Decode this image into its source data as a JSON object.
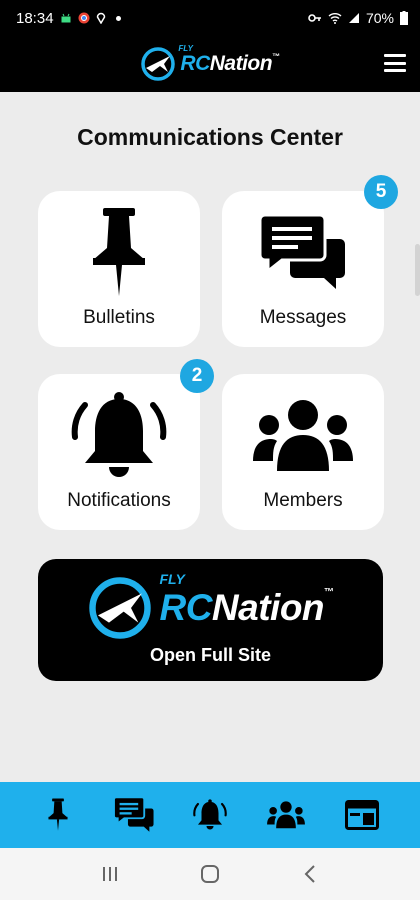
{
  "status_bar": {
    "time": "18:34",
    "battery": "70%"
  },
  "header": {
    "logo_fly": "FLY",
    "logo_rc": "RC",
    "logo_nation": "Nation",
    "logo_tm": "™",
    "menu_icon": "hamburger-menu-icon"
  },
  "page": {
    "title": "Communications Center"
  },
  "tiles": [
    {
      "label": "Bulletins",
      "icon": "pushpin-icon",
      "badge": ""
    },
    {
      "label": "Messages",
      "icon": "chat-bubbles-icon",
      "badge": "5"
    },
    {
      "label": "Notifications",
      "icon": "bell-ringing-icon",
      "badge": "2"
    },
    {
      "label": "Members",
      "icon": "group-icon",
      "badge": ""
    }
  ],
  "full_site": {
    "label": "Open Full Site",
    "logo_fly": "FLY",
    "logo_rc": "RC",
    "logo_nation": "Nation",
    "logo_tm": "™"
  },
  "bottom_nav": [
    "pushpin-icon",
    "chat-bubbles-icon",
    "bell-icon",
    "group-icon",
    "browser-icon"
  ],
  "colors": {
    "accent": "#1fb0ec",
    "badge": "#1fa7e1",
    "background": "#ececec"
  }
}
